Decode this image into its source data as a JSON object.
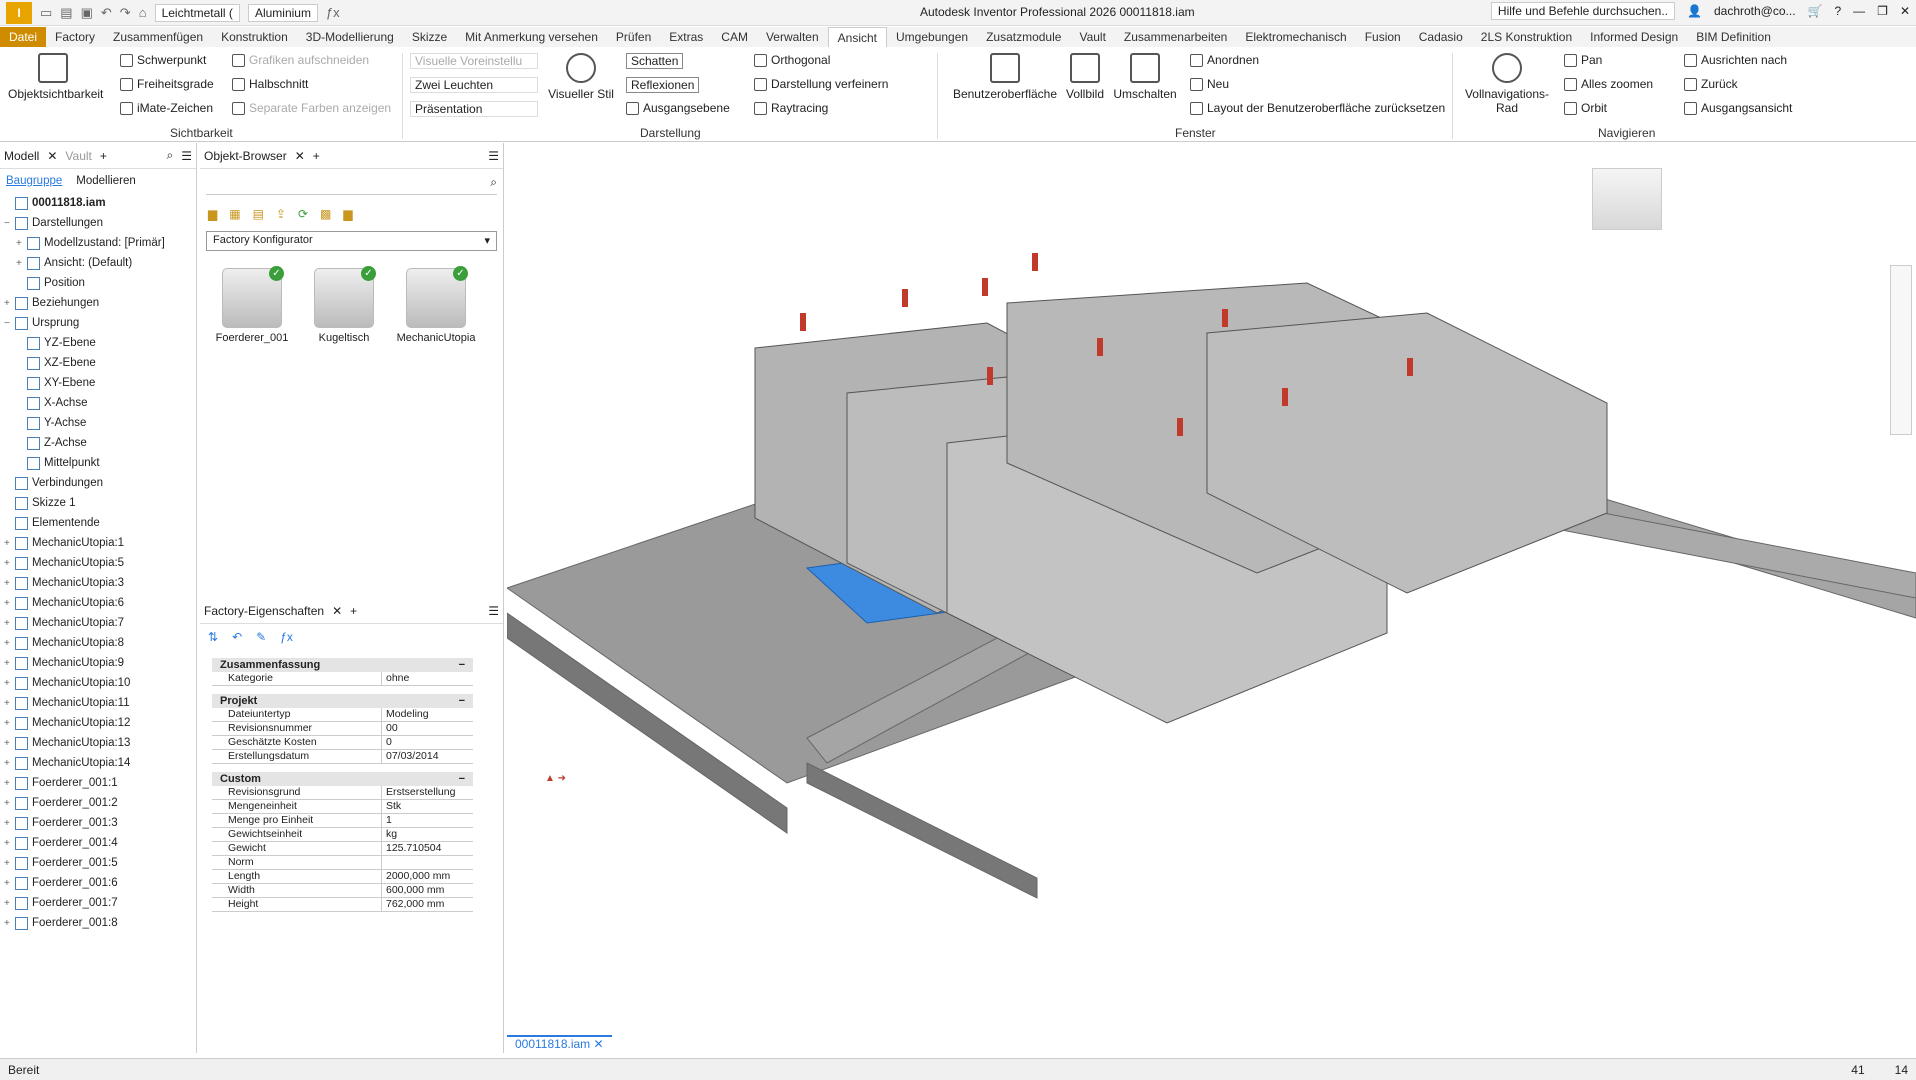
{
  "qat": {
    "material": "Leichtmetall (",
    "appearance": "Aluminium",
    "title": "Autodesk Inventor Professional 2026   00011818.iam",
    "search": "Hilfe und Befehle durchsuchen..",
    "user": "dachroth@co..."
  },
  "tabs": [
    "Datei",
    "Factory",
    "Zusammenfügen",
    "Konstruktion",
    "3D-Modellierung",
    "Skizze",
    "Mit Anmerkung versehen",
    "Prüfen",
    "Extras",
    "CAM",
    "Verwalten",
    "Ansicht",
    "Umgebungen",
    "Zusatzmodule",
    "Vault",
    "Zusammenarbeiten",
    "Elektromechanisch",
    "Fusion",
    "Cadasio",
    "2LS Konstruktion",
    "Informed Design",
    "BIM Definition"
  ],
  "ribbon": {
    "objsicht": "Objektsichtbarkeit",
    "schwerpunkt": "Schwerpunkt",
    "freiheit": "Freiheitsgrade",
    "imate": "iMate-Zeichen",
    "grafiken": "Grafiken aufschneiden",
    "halbschnitt": "Halbschnitt",
    "separate": "Separate Farben anzeigen",
    "g_sicht": "Sichtbarkeit",
    "visvor": "Visuelle Voreinstellu",
    "zwei": "Zwei Leuchten",
    "praes": "Präsentation",
    "visstil": "Visueller Stil",
    "schatten": "Schatten",
    "reflex": "Reflexionen",
    "ausgang": "Ausgangsebene",
    "ortho": "Orthogonal",
    "verfeinern": "Darstellung verfeinern",
    "raytrace": "Raytracing",
    "g_darst": "Darstellung",
    "benutzer": "Benutzeroberfläche",
    "vollbild": "Vollbild",
    "umschalten": "Umschalten",
    "anordnen": "Anordnen",
    "neu": "Neu",
    "layout": "Layout der Benutzeroberfläche zurücksetzen",
    "g_fenster": "Fenster",
    "vollnav": "Vollnavigations-Rad",
    "pan": "Pan",
    "zoomen": "Alles zoomen",
    "orbit": "Orbit",
    "ausrichten": "Ausrichten nach",
    "zurueck": "Zurück",
    "ausgangsansicht": "Ausgangsansicht",
    "g_nav": "Navigieren"
  },
  "model_panel": {
    "tab1": "Modell",
    "tab2": "Vault",
    "sub1": "Baugruppe",
    "sub2": "Modellieren"
  },
  "tree": [
    {
      "label": "00011818.iam",
      "lvl": 0,
      "pm": ""
    },
    {
      "label": "Darstellungen",
      "lvl": 0,
      "pm": "−"
    },
    {
      "label": "Modellzustand: [Primär]",
      "lvl": 1,
      "pm": "+"
    },
    {
      "label": "Ansicht: (Default)",
      "lvl": 1,
      "pm": "+"
    },
    {
      "label": "Position",
      "lvl": 1,
      "pm": ""
    },
    {
      "label": "Beziehungen",
      "lvl": 0,
      "pm": "+"
    },
    {
      "label": "Ursprung",
      "lvl": 0,
      "pm": "−"
    },
    {
      "label": "YZ-Ebene",
      "lvl": 1,
      "pm": ""
    },
    {
      "label": "XZ-Ebene",
      "lvl": 1,
      "pm": ""
    },
    {
      "label": "XY-Ebene",
      "lvl": 1,
      "pm": ""
    },
    {
      "label": "X-Achse",
      "lvl": 1,
      "pm": ""
    },
    {
      "label": "Y-Achse",
      "lvl": 1,
      "pm": ""
    },
    {
      "label": "Z-Achse",
      "lvl": 1,
      "pm": ""
    },
    {
      "label": "Mittelpunkt",
      "lvl": 1,
      "pm": ""
    },
    {
      "label": "Verbindungen",
      "lvl": 0,
      "pm": ""
    },
    {
      "label": "Skizze 1",
      "lvl": 0,
      "pm": ""
    },
    {
      "label": "Elementende",
      "lvl": 0,
      "pm": ""
    },
    {
      "label": "MechanicUtopia:1",
      "lvl": 0,
      "pm": "+"
    },
    {
      "label": "MechanicUtopia:5",
      "lvl": 0,
      "pm": "+"
    },
    {
      "label": "MechanicUtopia:3",
      "lvl": 0,
      "pm": "+"
    },
    {
      "label": "MechanicUtopia:6",
      "lvl": 0,
      "pm": "+"
    },
    {
      "label": "MechanicUtopia:7",
      "lvl": 0,
      "pm": "+"
    },
    {
      "label": "MechanicUtopia:8",
      "lvl": 0,
      "pm": "+"
    },
    {
      "label": "MechanicUtopia:9",
      "lvl": 0,
      "pm": "+"
    },
    {
      "label": "MechanicUtopia:10",
      "lvl": 0,
      "pm": "+"
    },
    {
      "label": "MechanicUtopia:11",
      "lvl": 0,
      "pm": "+"
    },
    {
      "label": "MechanicUtopia:12",
      "lvl": 0,
      "pm": "+"
    },
    {
      "label": "MechanicUtopia:13",
      "lvl": 0,
      "pm": "+"
    },
    {
      "label": "MechanicUtopia:14",
      "lvl": 0,
      "pm": "+"
    },
    {
      "label": "Foerderer_001:1",
      "lvl": 0,
      "pm": "+"
    },
    {
      "label": "Foerderer_001:2",
      "lvl": 0,
      "pm": "+"
    },
    {
      "label": "Foerderer_001:3",
      "lvl": 0,
      "pm": "+"
    },
    {
      "label": "Foerderer_001:4",
      "lvl": 0,
      "pm": "+"
    },
    {
      "label": "Foerderer_001:5",
      "lvl": 0,
      "pm": "+"
    },
    {
      "label": "Foerderer_001:6",
      "lvl": 0,
      "pm": "+"
    },
    {
      "label": "Foerderer_001:7",
      "lvl": 0,
      "pm": "+"
    },
    {
      "label": "Foerderer_001:8",
      "lvl": 0,
      "pm": "+"
    }
  ],
  "browser": {
    "tab": "Objekt-Browser",
    "dropdown": "Factory Konfigurator",
    "items": [
      "Foerderer_001",
      "Kugeltisch",
      "MechanicUtopia"
    ]
  },
  "props": {
    "tab": "Factory-Eigenschaften",
    "sections": [
      {
        "title": "Zusammenfassung",
        "rows": [
          [
            "Kategorie",
            "ohne"
          ]
        ]
      },
      {
        "title": "Projekt",
        "rows": [
          [
            "Dateiuntertyp",
            "Modeling"
          ],
          [
            "Revisionsnummer",
            "00"
          ],
          [
            "Geschätzte Kosten",
            "0"
          ],
          [
            "Erstellungsdatum",
            "07/03/2014"
          ]
        ]
      },
      {
        "title": "Custom",
        "rows": [
          [
            "Revisionsgrund",
            "Erstserstellung"
          ],
          [
            "Mengeneinheit",
            "Stk"
          ],
          [
            "Menge pro Einheit",
            "1"
          ],
          [
            "Gewichtseinheit",
            "kg"
          ],
          [
            "Gewicht",
            "125.710504"
          ],
          [
            "Norm",
            ""
          ],
          [
            "Length",
            "2000,000 mm"
          ],
          [
            "Width",
            "600,000 mm"
          ],
          [
            "Height",
            "762,000 mm"
          ]
        ]
      }
    ]
  },
  "doc_tab": "00011818.iam",
  "status": {
    "left": "Bereit",
    "n1": "41",
    "n2": "14"
  }
}
